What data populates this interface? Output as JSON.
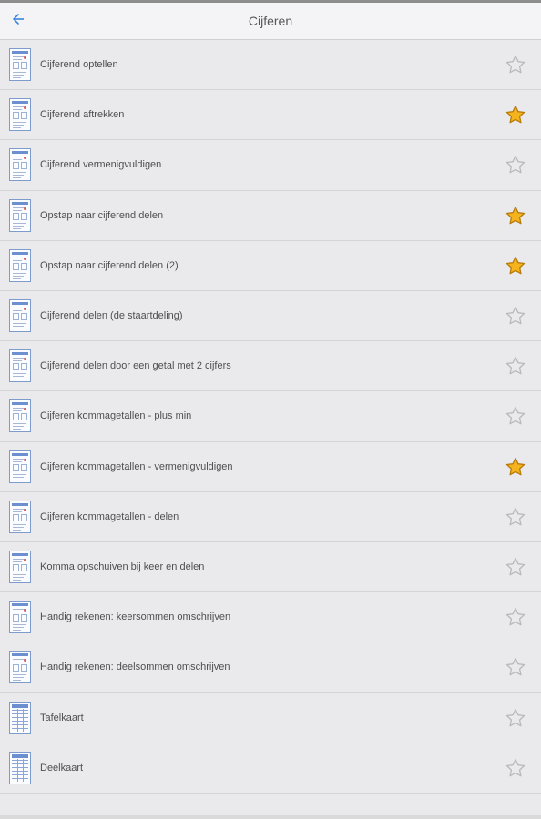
{
  "header": {
    "title": "Cijferen"
  },
  "colors": {
    "star_active": "#f5b41d",
    "star_active_stroke": "#b67b0b",
    "star_inactive_stroke": "#b9b9bc",
    "thumbnail_border": "#7d9ccc"
  },
  "items": [
    {
      "label": "Cijferend optellen",
      "favorite": false,
      "thumbnail": "worksheet-thumbnail"
    },
    {
      "label": "Cijferend aftrekken",
      "favorite": true,
      "thumbnail": "worksheet-thumbnail"
    },
    {
      "label": "Cijferend vermenigvuldigen",
      "favorite": false,
      "thumbnail": "worksheet-thumbnail"
    },
    {
      "label": "Opstap naar cijferend delen",
      "favorite": true,
      "thumbnail": "worksheet-thumbnail"
    },
    {
      "label": "Opstap naar cijferend delen (2)",
      "favorite": true,
      "thumbnail": "worksheet-thumbnail"
    },
    {
      "label": "Cijferend delen (de staartdeling)",
      "favorite": false,
      "thumbnail": "worksheet-thumbnail"
    },
    {
      "label": "Cijferend delen door een getal met 2 cijfers",
      "favorite": false,
      "thumbnail": "worksheet-thumbnail"
    },
    {
      "label": "Cijferen kommagetallen - plus min",
      "favorite": false,
      "thumbnail": "worksheet-thumbnail"
    },
    {
      "label": "Cijferen kommagetallen - vermenigvuldigen",
      "favorite": true,
      "thumbnail": "worksheet-thumbnail"
    },
    {
      "label": "Cijferen kommagetallen - delen",
      "favorite": false,
      "thumbnail": "worksheet-thumbnail"
    },
    {
      "label": "Komma opschuiven bij keer en delen",
      "favorite": false,
      "thumbnail": "worksheet-thumbnail"
    },
    {
      "label": "Handig rekenen: keersommen omschrijven",
      "favorite": false,
      "thumbnail": "worksheet-thumbnail"
    },
    {
      "label": "Handig rekenen: deelsommen omschrijven",
      "favorite": false,
      "thumbnail": "worksheet-thumbnail"
    },
    {
      "label": "Tafelkaart",
      "favorite": false,
      "thumbnail": "table-chart-thumbnail"
    },
    {
      "label": "Deelkaart",
      "favorite": false,
      "thumbnail": "table-chart-thumbnail"
    }
  ]
}
